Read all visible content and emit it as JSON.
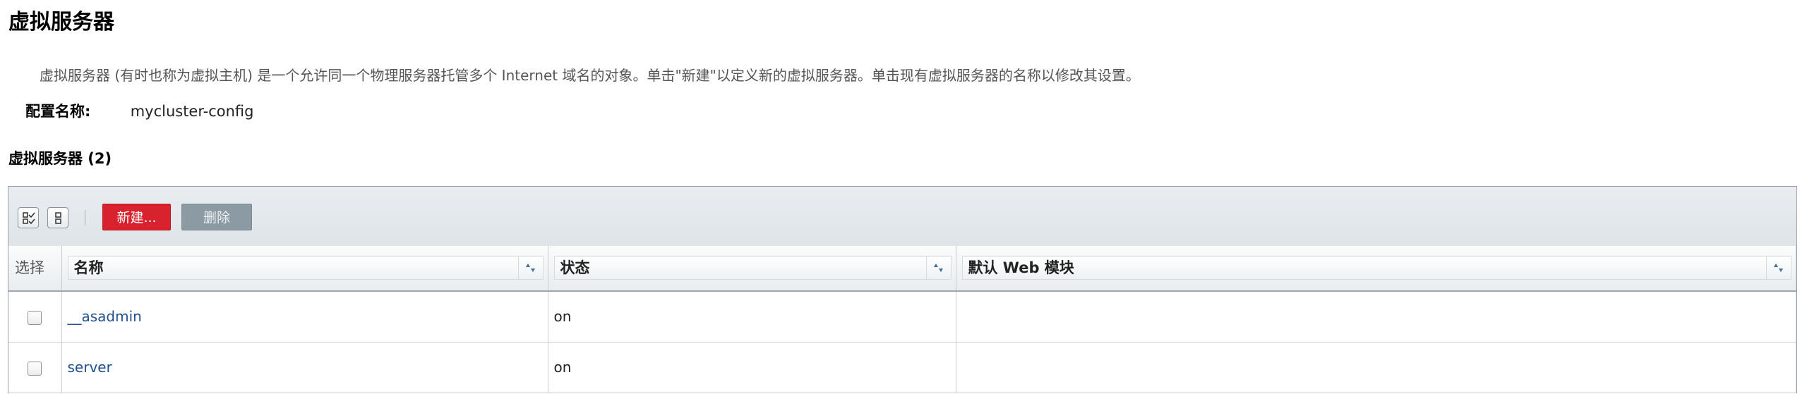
{
  "page": {
    "title": "虚拟服务器",
    "help_text": "虚拟服务器 (有时也称为虚拟主机) 是一个允许同一个物理服务器托管多个 Internet 域名的对象。单击\"新建\"以定义新的虚拟服务器。单击现有虚拟服务器的名称以修改其设置。"
  },
  "config": {
    "label": "配置名称:",
    "value": "mycluster-config"
  },
  "table": {
    "title": "虚拟服务器 (2)",
    "toolbar": {
      "select_all_icon": "select-all-icon",
      "deselect_all_icon": "deselect-all-icon",
      "new_label": "新建...",
      "delete_label": "删除"
    },
    "columns": [
      {
        "key": "select",
        "label": "选择",
        "sortable": false
      },
      {
        "key": "name",
        "label": "名称",
        "sortable": true
      },
      {
        "key": "status",
        "label": "状态",
        "sortable": true
      },
      {
        "key": "default_web_module",
        "label": "默认 Web 模块",
        "sortable": true
      }
    ],
    "rows": [
      {
        "name": "__asadmin",
        "status": "on",
        "default_web_module": ""
      },
      {
        "name": "server",
        "status": "on",
        "default_web_module": ""
      }
    ]
  },
  "colors": {
    "new_button": "#d8232f",
    "delete_button": "#8c9aa3",
    "link": "#1f4f8f"
  }
}
